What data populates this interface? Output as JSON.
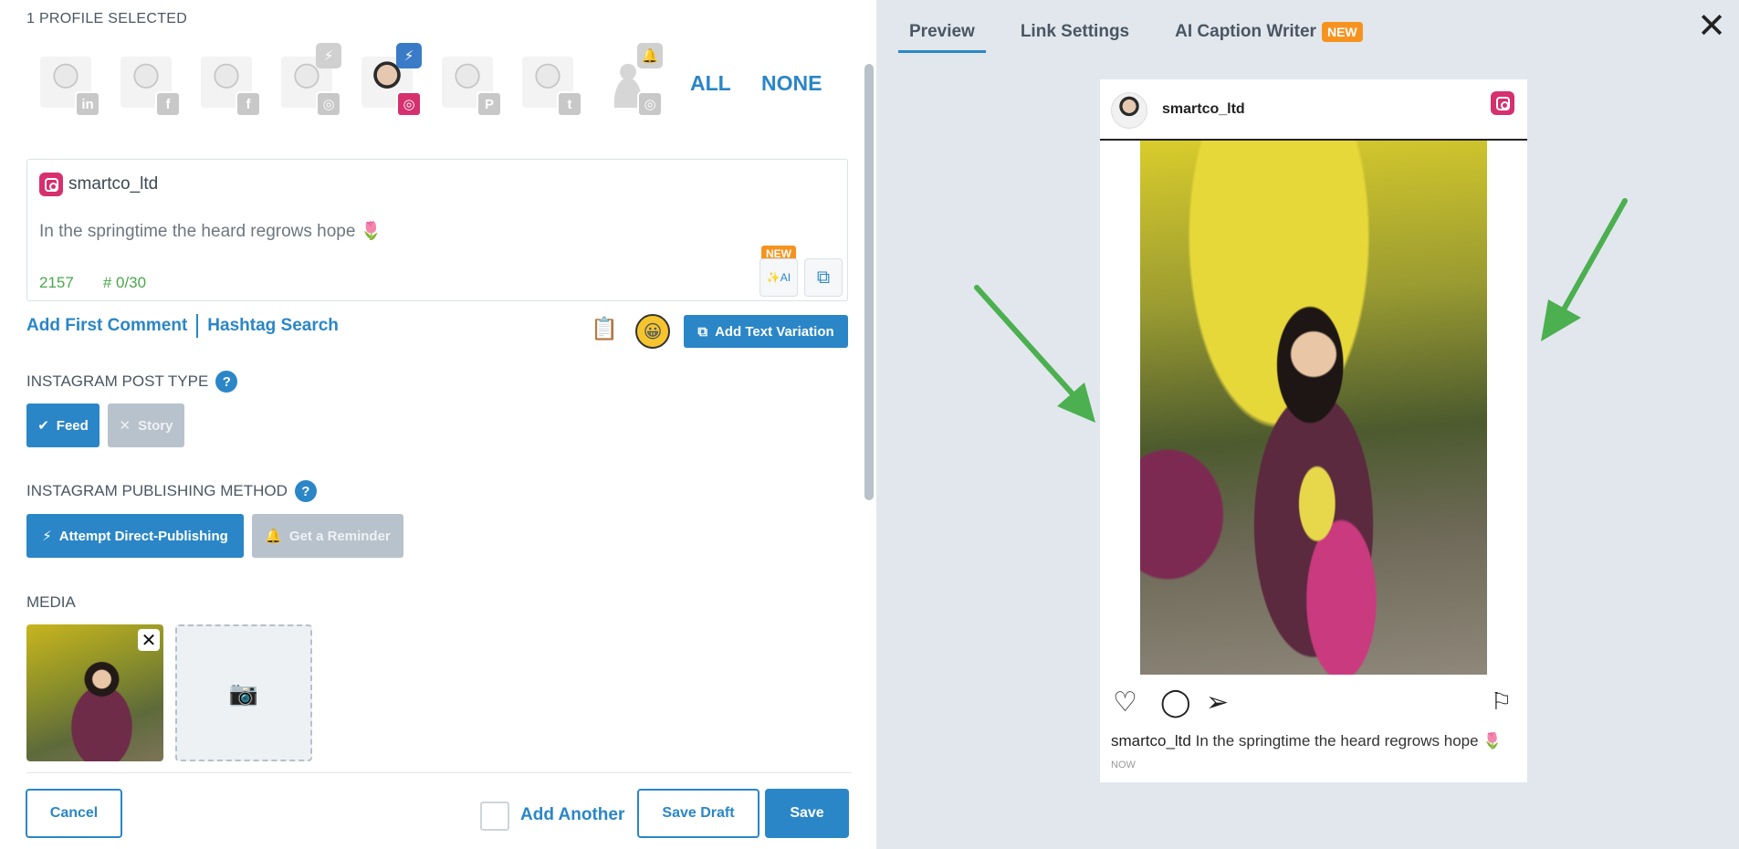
{
  "left": {
    "profile_count": "1 PROFILE SELECTED",
    "profiles": [
      {
        "network": "linkedin-icon",
        "glyph": "in",
        "selected": false
      },
      {
        "network": "facebook-icon",
        "glyph": "f",
        "selected": false
      },
      {
        "network": "facebook-icon",
        "glyph": "f",
        "selected": false
      },
      {
        "network": "instagram-icon",
        "glyph": "◎",
        "selected": false,
        "bolt": true
      },
      {
        "network": "instagram-icon",
        "glyph": "◎",
        "selected": true,
        "bolt": true
      },
      {
        "network": "pinterest-icon",
        "glyph": "P",
        "selected": false
      },
      {
        "network": "twitter-icon",
        "glyph": "t",
        "selected": false
      },
      {
        "network": "instagram-icon",
        "glyph": "◎",
        "selected": false,
        "reminder": true
      }
    ],
    "select_all": "ALL",
    "select_none": "NONE",
    "post": {
      "handle": "smartco_ltd",
      "text": "In the springtime the heard regrows hope 🌷",
      "char_count": "2157",
      "hashtag_count": "# 0/30",
      "ai_new_tag": "NEW",
      "ai_label": "AI"
    },
    "links": {
      "first_comment": "Add First Comment",
      "hashtag_search": "Hashtag Search",
      "add_variation": "Add Text Variation"
    },
    "post_type": {
      "label": "INSTAGRAM POST TYPE",
      "feed": "Feed",
      "story": "Story"
    },
    "publishing": {
      "label": "INSTAGRAM PUBLISHING METHOD",
      "direct": "Attempt Direct-Publishing",
      "reminder": "Get a Reminder"
    },
    "media_label": "MEDIA",
    "footer": {
      "cancel": "Cancel",
      "add_another": "Add Another",
      "save_draft": "Save Draft",
      "save": "Save"
    }
  },
  "right": {
    "tabs": [
      "Preview",
      "Link Settings",
      "AI Caption Writer"
    ],
    "tab_new": "NEW",
    "preview": {
      "username": "smartco_ltd",
      "caption_user": "smartco_ltd",
      "caption_text": "In the springtime the heard regrows hope 🌷",
      "timestamp": "NOW"
    }
  },
  "colors": {
    "accent": "#2a86c7",
    "instagram": "#d6306e",
    "new_badge": "#f6931f",
    "counter_green": "#4aa84b",
    "arrow_green": "#4caf50",
    "panel_bg": "#e1e7ed"
  }
}
